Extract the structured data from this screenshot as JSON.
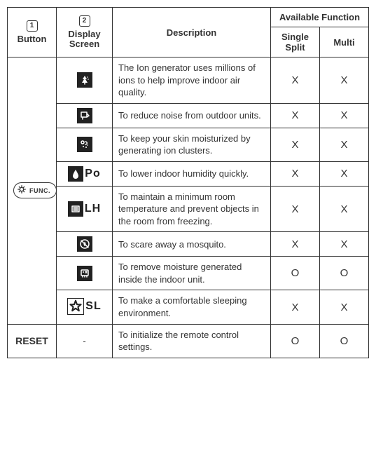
{
  "headers": {
    "button_num": "1",
    "button_label": "Button",
    "display_num": "2",
    "display_label": "Display Screen",
    "description": "Description",
    "available_function": "Available Function",
    "single_split": "Single Split",
    "multi": "Multi"
  },
  "marks": {
    "X": "X",
    "O": "O",
    "dash": "-"
  },
  "func_button": {
    "label": "FUNC."
  },
  "rows": [
    {
      "icon": "ion",
      "side_text": "",
      "description": "The Ion generator uses millions of ions to help improve indoor air quality.",
      "single": "X",
      "multi": "X"
    },
    {
      "icon": "noise",
      "side_text": "",
      "description": "To reduce noise from outdoor units.",
      "single": "X",
      "multi": "X"
    },
    {
      "icon": "moisturize",
      "side_text": "",
      "description": "To keep your skin moisturized by generating ion clusters.",
      "single": "X",
      "multi": "X"
    },
    {
      "icon": "drop",
      "side_text": "Po",
      "description": "To lower indoor humidity quickly.",
      "single": "X",
      "multi": "X"
    },
    {
      "icon": "lh",
      "side_text": "LH",
      "description": "To maintain a minimum room temperature and prevent objects in the room from freezing.",
      "single": "X",
      "multi": "X"
    },
    {
      "icon": "mosquito",
      "side_text": "",
      "description": "To scare away a mosquito.",
      "single": "X",
      "multi": "X"
    },
    {
      "icon": "dry",
      "side_text": "",
      "description": "To remove moisture generated inside the indoor unit.",
      "single": "O",
      "multi": "O"
    },
    {
      "icon": "sleep",
      "side_text": "SL",
      "description": "To make a comfortable sleeping environment.",
      "single": "X",
      "multi": "X"
    }
  ],
  "reset_row": {
    "button": "RESET",
    "display": "-",
    "description": "To initialize the remote control settings.",
    "single": "O",
    "multi": "O"
  }
}
